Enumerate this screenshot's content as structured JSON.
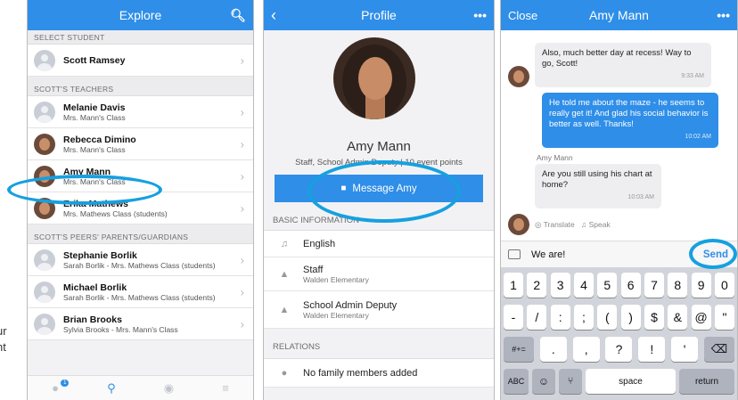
{
  "explore": {
    "title": "Explore",
    "sections": [
      {
        "header": "SELECT STUDENT",
        "rows": [
          {
            "name": "Scott Ramsey",
            "sub": "",
            "avatar": "generic"
          }
        ]
      },
      {
        "header": "SCOTT'S TEACHERS",
        "rows": [
          {
            "name": "Melanie Davis",
            "sub": "Mrs. Mann's Class",
            "avatar": "generic"
          },
          {
            "name": "Rebecca Dimino",
            "sub": "Mrs. Mann's Class",
            "avatar": "photo"
          },
          {
            "name": "Amy Mann",
            "sub": "Mrs. Mann's Class",
            "avatar": "photo"
          },
          {
            "name": "Erika Mathews",
            "sub": "Mrs. Mathews Class (students)",
            "avatar": "photo"
          }
        ]
      },
      {
        "header": "SCOTT'S PEERS' PARENTS/GUARDIANS",
        "rows": [
          {
            "name": "Stephanie Borlik",
            "sub": "Sarah Borlik - Mrs. Mathews Class (students)",
            "avatar": "generic"
          },
          {
            "name": "Michael Borlik",
            "sub": "Sarah Borlik - Mrs. Mathews Class (students)",
            "avatar": "generic"
          },
          {
            "name": "Brian Brooks",
            "sub": "Sylvia Brooks - Mrs. Mann's Class",
            "avatar": "generic"
          }
        ]
      }
    ],
    "tab_badge": "1"
  },
  "profile": {
    "title": "Profile",
    "name": "Amy Mann",
    "role": "Staff, School Admin Deputy | 10 event points",
    "message_button": "Message Amy",
    "basic_header": "BASIC INFORMATION",
    "basic_rows": [
      {
        "main": "English",
        "sub": "",
        "icon": "speak-icon"
      },
      {
        "main": "Staff",
        "sub": "Walden Elementary",
        "icon": "graduation-cap-icon"
      },
      {
        "main": "School Admin Deputy",
        "sub": "Walden Elementary",
        "icon": "graduation-cap-icon"
      }
    ],
    "relations_header": "RELATIONS",
    "relations_row": "No family members added"
  },
  "chat": {
    "close": "Close",
    "title": "Amy Mann",
    "messages": [
      {
        "dir": "in",
        "text": "Also, much better day at recess! Way to go, Scott!",
        "time": "9:33 AM"
      },
      {
        "dir": "out",
        "text": "He told me about the maze - he seems to really get it! And glad his social behavior is better as well. Thanks!",
        "time": "10:02 AM"
      },
      {
        "dir": "in",
        "sender": "Amy Mann",
        "text": "Are you still using his chart at home?",
        "time": "10:03 AM"
      }
    ],
    "translate": "Translate",
    "speak": "Speak",
    "input_value": "We are!",
    "send": "Send"
  },
  "keyboard": {
    "row1": [
      "1",
      "2",
      "3",
      "4",
      "5",
      "6",
      "7",
      "8",
      "9",
      "0"
    ],
    "row2": [
      "-",
      "/",
      ":",
      ";",
      "(",
      ")",
      "$",
      "&",
      "@",
      "\""
    ],
    "row3_left": "#+=",
    "row3": [
      ".",
      ",",
      "?",
      "!",
      "'"
    ],
    "row4_left": "ABC",
    "space": "space",
    "return": "return"
  },
  "annotation": {
    "left_text_1": "ur",
    "left_text_2": "nt"
  },
  "colors": {
    "accent": "#2f8ee8",
    "highlight_ellipse": "#16a0e0"
  }
}
